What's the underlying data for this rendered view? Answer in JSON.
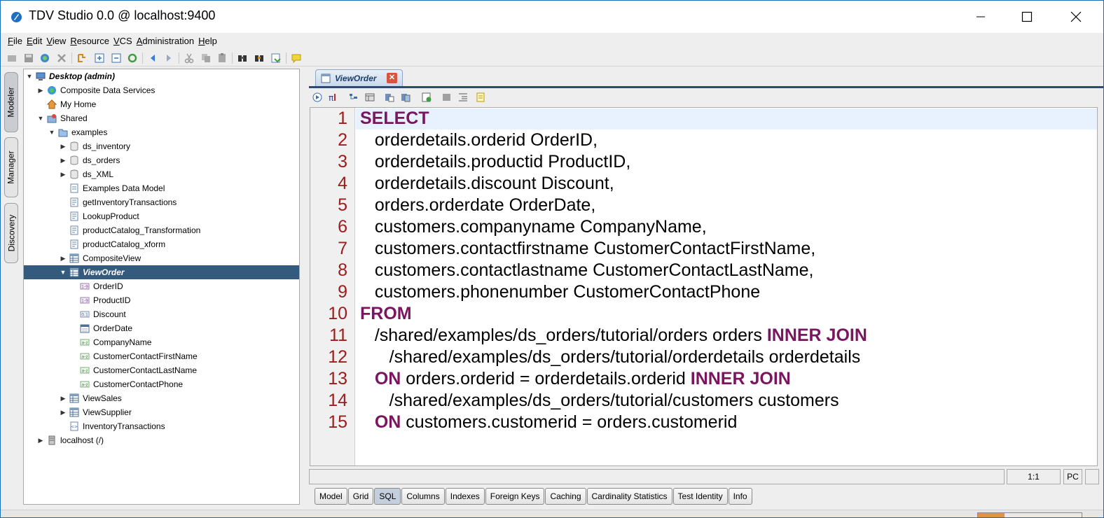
{
  "window": {
    "title": "TDV Studio 0.0 @ localhost:9400"
  },
  "menu": [
    {
      "u": "F",
      "rest": "ile"
    },
    {
      "u": "E",
      "rest": "dit"
    },
    {
      "u": "V",
      "rest": "iew"
    },
    {
      "u": "R",
      "rest": "esource"
    },
    {
      "u": "V",
      "rest": "CS"
    },
    {
      "u": "A",
      "rest": "dministration"
    },
    {
      "u": "H",
      "rest": "elp"
    }
  ],
  "side_tabs": [
    "Modeler",
    "Manager",
    "Discovery"
  ],
  "tree": {
    "root": "Desktop (admin)",
    "composite": "Composite Data Services",
    "home": "My Home",
    "shared": "Shared",
    "examples": "examples",
    "ds_inventory": "ds_inventory",
    "ds_orders": "ds_orders",
    "ds_xml": "ds_XML",
    "examples_model": "Examples Data Model",
    "get_inventory": "getInventoryTransactions",
    "lookup": "LookupProduct",
    "catalog_transformation": "productCatalog_Transformation",
    "catalog_xform": "productCatalog_xform",
    "composite_view": "CompositeView",
    "view_order": "ViewOrder",
    "col_orderid": "OrderID",
    "col_productid": "ProductID",
    "col_discount": "Discount",
    "col_orderdate": "OrderDate",
    "col_companyname": "CompanyName",
    "col_first": "CustomerContactFirstName",
    "col_last": "CustomerContactLastName",
    "col_phone": "CustomerContactPhone",
    "view_sales": "ViewSales",
    "view_supplier": "ViewSupplier",
    "inventory_tx": "InventoryTransactions",
    "localhost": "localhost (/)"
  },
  "editor": {
    "tab_label": "ViewOrder",
    "tab_close": "✕",
    "line_numbers": [
      "1",
      "2",
      "3",
      "4",
      "5",
      "6",
      "7",
      "8",
      "9",
      "10",
      "11",
      "12",
      "13",
      "14",
      "15"
    ],
    "code": {
      "l1_kw": "SELECT",
      "l2": "   orderdetails.orderid OrderID,",
      "l3": "   orderdetails.productid ProductID,",
      "l4": "   orderdetails.discount Discount,",
      "l5": "   orders.orderdate OrderDate,",
      "l6": "   customers.companyname CompanyName,",
      "l7": "   customers.contactfirstname CustomerContactFirstName,",
      "l8": "   customers.contactlastname CustomerContactLastName,",
      "l9": "   customers.phonenumber CustomerContactPhone",
      "l10_kw": "FROM",
      "l11_text": "   /shared/examples/ds_orders/tutorial/orders orders ",
      "l11_kw": "INNER JOIN",
      "l12": "      /shared/examples/ds_orders/tutorial/orderdetails orderdetails",
      "l13_pre": "   ",
      "l13_kw1": "ON",
      "l13_text": " orders.orderid = orderdetails.orderid ",
      "l13_kw2": "INNER JOIN",
      "l14": "      /shared/examples/ds_orders/tutorial/customers customers",
      "l15_pre": "   ",
      "l15_kw": "ON",
      "l15_text": " customers.customerid = orders.customerid"
    },
    "cursor_pos": "1:1",
    "mode": "PC"
  },
  "bottom_tabs": [
    "Model",
    "Grid",
    "SQL",
    "Columns",
    "Indexes",
    "Foreign Keys",
    "Caching",
    "Cardinality Statistics",
    "Test Identity",
    "Info"
  ],
  "active_bottom_tab": "SQL",
  "memory_fill_fraction": 0.26,
  "colors": {
    "keyword": "#7a1560",
    "line_number": "#9c1b1b",
    "selection": "#345a7e"
  }
}
